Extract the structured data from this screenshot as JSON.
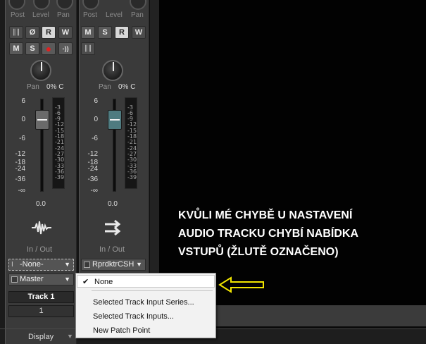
{
  "top_labels": [
    "Post",
    "Level",
    "Pan"
  ],
  "strip1": {
    "buttons_row1": [
      {
        "label": "║║",
        "icon": "midi-input-icon"
      },
      {
        "label": "Ø",
        "icon": "phase-invert-icon"
      },
      {
        "label": "R"
      },
      {
        "label": "W"
      }
    ],
    "buttons_row2": [
      {
        "label": "M"
      },
      {
        "label": "S"
      },
      {
        "label": "●",
        "icon": "record-arm-icon"
      },
      {
        "label": "◦))",
        "icon": "input-echo-icon"
      }
    ],
    "pan_label": "Pan",
    "pan_value": "0% C",
    "fader_scale": [
      "6",
      "0",
      "-6",
      "-12",
      "-18",
      "-24",
      "-36",
      "-∞"
    ],
    "meter_scale": [
      "-3",
      "-6",
      "-9",
      "-12",
      "-15",
      "-18",
      "-21",
      "-24",
      "-27",
      "-30",
      "-33",
      "-36",
      "-39"
    ],
    "fader_value": "0.0",
    "icon": "audio-waveform-icon",
    "io_label": "In / Out",
    "input": "-None-",
    "output": "Master",
    "track_name": "Track 1",
    "track_number": "1"
  },
  "strip2": {
    "buttons_row1": [
      {
        "label": "M"
      },
      {
        "label": "S"
      },
      {
        "label": "R"
      },
      {
        "label": "W"
      }
    ],
    "buttons_row2": [
      {
        "label": "║║",
        "icon": "midi-input-icon"
      }
    ],
    "pan_label": "Pan",
    "pan_value": "0% C",
    "fader_scale": [
      "6",
      "0",
      "-6",
      "-12",
      "-18",
      "-24",
      "-36",
      "-∞"
    ],
    "meter_scale": [
      "-3",
      "-6",
      "-9",
      "-12",
      "-15",
      "-18",
      "-21",
      "-24",
      "-27",
      "-30",
      "-33",
      "-36",
      "-39"
    ],
    "fader_value": "0.0",
    "icon": "bus-arrows-icon",
    "io_label": "In / Out",
    "output": "RprdktrCSH"
  },
  "menu": {
    "items": [
      {
        "label": "None",
        "checked": true
      },
      {
        "label": "Selected Track Input Series...",
        "checked": false
      },
      {
        "label": "Selected Track Inputs...",
        "checked": false
      },
      {
        "label": "New Patch Point",
        "checked": false
      }
    ]
  },
  "annotation": {
    "lines": [
      "KVŮLI MÉ CHYBĚ U NASTAVENÍ",
      "AUDIO TRACKU CHYBÍ NABÍDKA",
      "VSTUPŮ (ŽLUTĚ OZNAČENO)"
    ],
    "arrow_color": "#f2e600"
  },
  "bottom": {
    "display_label": "Display"
  },
  "colors": {
    "strip_bg": "#3a3a3a",
    "fader_cap_1": "#6a6a6a",
    "fader_cap_2": "#4f7b80",
    "record": "#e02020"
  }
}
